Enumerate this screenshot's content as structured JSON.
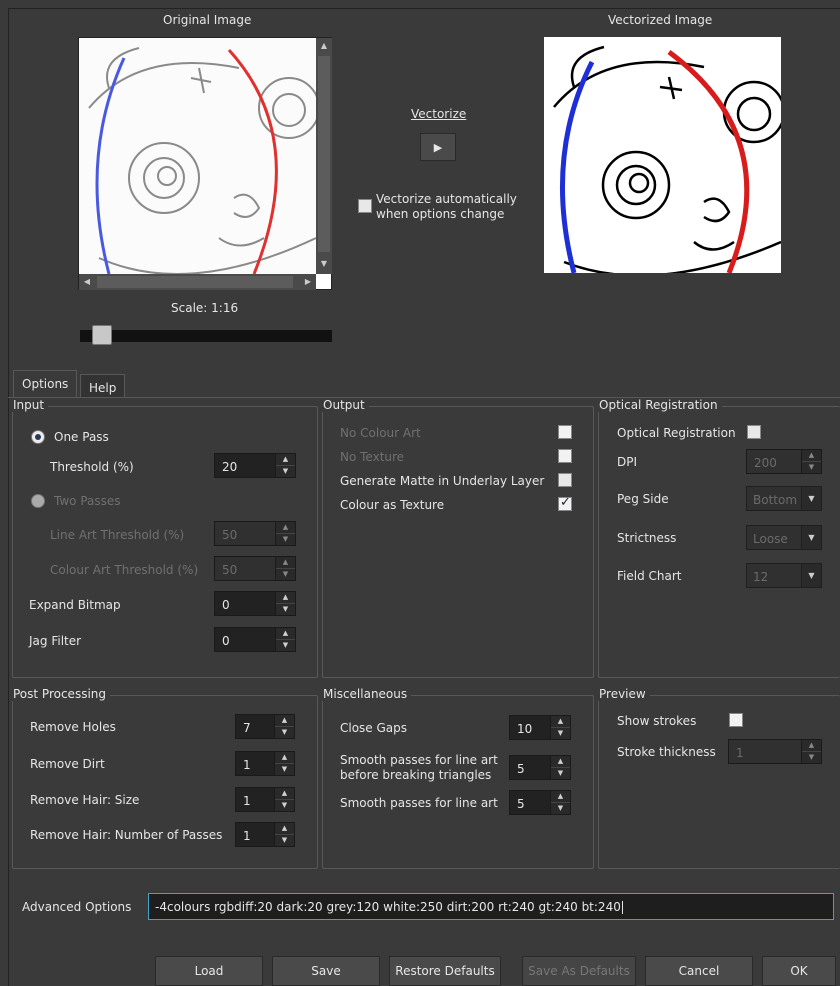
{
  "preview": {
    "original_label": "Original Image",
    "vectorized_label": "Vectorized Image",
    "vectorize_label": "Vectorize",
    "auto_vectorize_line1": "Vectorize automatically",
    "auto_vectorize_line2": "when options change",
    "auto_vectorize_checked": false,
    "scale_label": "Scale: 1:16",
    "scale_value": 0.05
  },
  "tabs": [
    {
      "label": "Options",
      "active": true
    },
    {
      "label": "Help",
      "active": false
    }
  ],
  "input": {
    "title": "Input",
    "one_pass_label": "One Pass",
    "threshold_label": "Threshold (%)",
    "threshold_value": "20",
    "two_passes_label": "Two Passes",
    "line_art_threshold_label": "Line Art Threshold (%)",
    "line_art_threshold_value": "50",
    "colour_art_threshold_label": "Colour Art Threshold (%)",
    "colour_art_threshold_value": "50",
    "expand_bitmap_label": "Expand Bitmap",
    "expand_bitmap_value": "0",
    "jag_filter_label": "Jag Filter",
    "jag_filter_value": "0"
  },
  "output": {
    "title": "Output",
    "no_colour_art_label": "No Colour Art",
    "no_texture_label": "No Texture",
    "generate_matte_label": "Generate Matte in Underlay Layer",
    "colour_as_texture_label": "Colour as Texture",
    "colour_as_texture_checked": true
  },
  "optical": {
    "title": "Optical Registration",
    "optical_registration_label": "Optical Registration",
    "dpi_label": "DPI",
    "dpi_value": "200",
    "peg_side_label": "Peg Side",
    "peg_side_value": "Bottom",
    "strictness_label": "Strictness",
    "strictness_value": "Loose",
    "field_chart_label": "Field Chart",
    "field_chart_value": "12"
  },
  "post": {
    "title": "Post Processing",
    "remove_holes_label": "Remove Holes",
    "remove_holes_value": "7",
    "remove_dirt_label": "Remove Dirt",
    "remove_dirt_value": "1",
    "remove_hair_size_label": "Remove Hair: Size",
    "remove_hair_size_value": "1",
    "remove_hair_passes_label": "Remove Hair: Number of Passes",
    "remove_hair_passes_value": "1"
  },
  "misc": {
    "title": "Miscellaneous",
    "close_gaps_label": "Close Gaps",
    "close_gaps_value": "10",
    "smooth_breaking_line1": "Smooth passes for line art",
    "smooth_breaking_line2": "before breaking triangles",
    "smooth_breaking_value": "5",
    "smooth_passes_label": "Smooth passes for line art",
    "smooth_passes_value": "5"
  },
  "preview_section": {
    "title": "Preview",
    "show_strokes_label": "Show strokes",
    "stroke_thickness_label": "Stroke thickness",
    "stroke_thickness_value": "1"
  },
  "advanced": {
    "label": "Advanced Options",
    "value": "-4colours rgbdiff:20 dark:20 grey:120 white:250 dirt:200 rt:240 gt:240 bt:240"
  },
  "buttons": {
    "load": "Load",
    "save": "Save",
    "restore_defaults": "Restore Defaults",
    "save_as_defaults": "Save As Defaults",
    "cancel": "Cancel",
    "ok": "OK"
  },
  "colors": {
    "background": "#3a3a3a",
    "accent_blue": "#1f2fd6",
    "accent_red": "#d81b1b",
    "input_focus": "#3aa7c8"
  }
}
